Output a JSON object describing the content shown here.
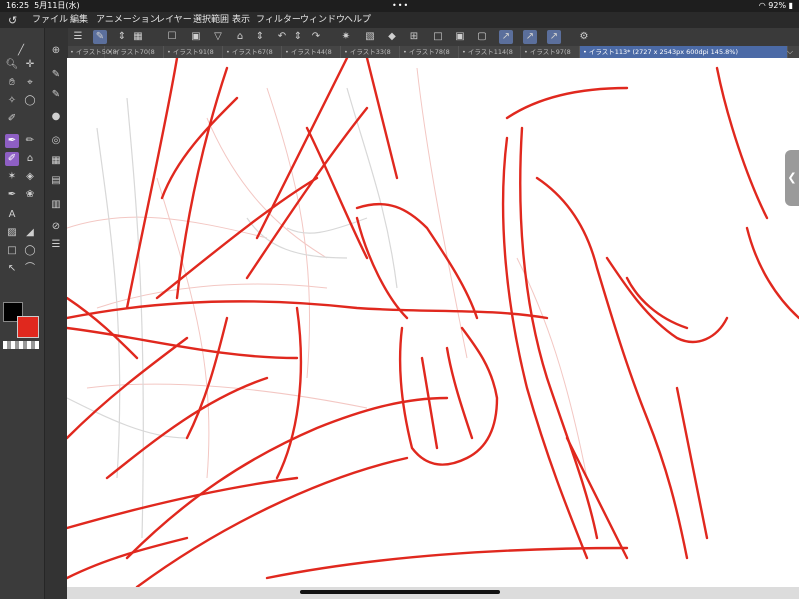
{
  "status": {
    "time": "16:25",
    "date": "5月11日(水)",
    "dots": "•••",
    "battery": "92%"
  },
  "menu": [
    "ファイル",
    "編集",
    "アニメーション",
    "レイヤー",
    "選択範囲",
    "表示",
    "フィルター",
    "ウィンドウ",
    "ヘルプ"
  ],
  "tabs": [
    "イラスト50(8",
    "イラスト70(8",
    "イラスト91(8",
    "イラスト67(8",
    "イラスト44(8",
    "イラスト33(8",
    "イラスト78(8",
    "イラスト114(8",
    "イラスト97(8",
    "イラスト113* (2727 x 2543px 600dpi 145.8%)"
  ],
  "colors": {
    "main": "#000000",
    "sub": "#e0281e",
    "stroke": "#e0281e"
  }
}
